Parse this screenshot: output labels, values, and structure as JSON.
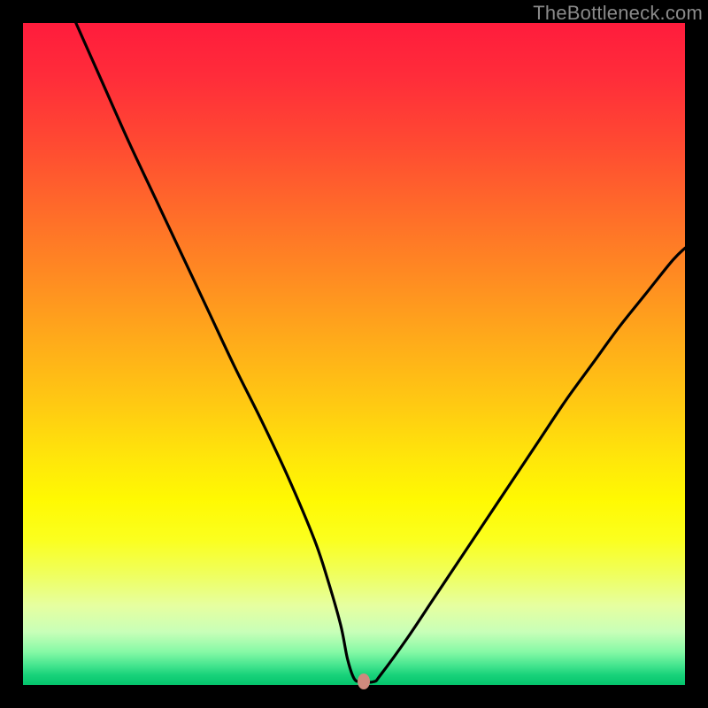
{
  "watermark": "TheBottleneck.com",
  "colors": {
    "frame": "#000000",
    "gradient_top": "#ff1c3c",
    "gradient_bottom": "#04c46c",
    "curve_stroke": "#000000",
    "marker_fill": "#cf8a7e",
    "watermark_text": "#8a8a8a"
  },
  "chart_data": {
    "type": "line",
    "title": "",
    "xlabel": "",
    "ylabel": "",
    "xlim": [
      0,
      100
    ],
    "ylim": [
      0,
      100
    ],
    "grid": false,
    "legend": false,
    "series": [
      {
        "name": "bottleneck-curve",
        "x": [
          8,
          12,
          16,
          20,
          24,
          28,
          32,
          36,
          40,
          44,
          46,
          48,
          49,
          50,
          51,
          53,
          54,
          58,
          62,
          66,
          70,
          74,
          78,
          82,
          86,
          90,
          94,
          98,
          100
        ],
        "y": [
          100,
          91,
          82,
          73.5,
          65,
          56.5,
          48,
          40,
          31.5,
          22,
          16,
          9,
          4,
          1,
          0.5,
          0.5,
          1.5,
          7,
          13,
          19,
          25,
          31,
          37,
          43,
          48.5,
          54,
          59,
          64,
          66
        ]
      }
    ],
    "marker": {
      "x": 51.5,
      "y": 0.5
    },
    "notes": "V-shaped bottleneck curve with minimum around x≈51. y values estimated from plot; no axes or tick labels shown."
  }
}
